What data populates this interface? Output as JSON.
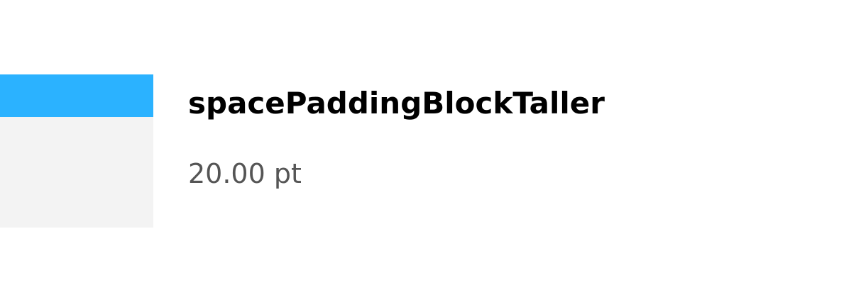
{
  "token": {
    "name": "spacePaddingBlockTaller",
    "value": "20.00 pt"
  },
  "colors": {
    "accent": "#2bb2ff",
    "swatch_background": "#f3f3f3",
    "name_text": "#000000",
    "value_text": "#555555"
  }
}
